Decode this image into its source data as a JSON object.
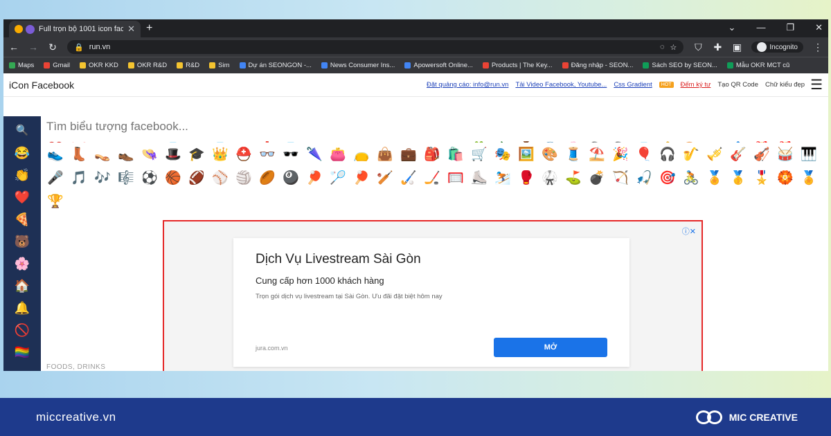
{
  "browser": {
    "tab_title": "Full trọn bộ 1001 icon faceb",
    "url": "run.vn",
    "incognito_label": "Incognito",
    "bookmarks": [
      {
        "label": "Maps",
        "color": "#34a853"
      },
      {
        "label": "Gmail",
        "color": "#ea4335"
      },
      {
        "label": "OKR KKD",
        "color": "#f4c430"
      },
      {
        "label": "OKR R&D",
        "color": "#f4c430"
      },
      {
        "label": "R&D",
        "color": "#f4c430"
      },
      {
        "label": "Sim",
        "color": "#f4c430"
      },
      {
        "label": "Dự án SEONGON -...",
        "color": "#4285f4"
      },
      {
        "label": "News Consumer Ins...",
        "color": "#4285f4"
      },
      {
        "label": "Apowersoft Online...",
        "color": "#4285f4"
      },
      {
        "label": "Products | The Key...",
        "color": "#ea4335"
      },
      {
        "label": "Đăng nhập - SEON...",
        "color": "#ea4335"
      },
      {
        "label": "Sách SEO by SEON...",
        "color": "#0f9d58"
      },
      {
        "label": "Mẫu OKR MCT cũ",
        "color": "#0f9d58"
      }
    ]
  },
  "site": {
    "name": "iCon Facebook",
    "links": [
      {
        "label": "Đặt quảng cáo: info@run.vn",
        "style": "link"
      },
      {
        "label": "Tải Video Facebook, Youtube...",
        "style": "link"
      },
      {
        "label": "Css Gradient",
        "style": "link"
      },
      {
        "label": "Đếm ký tự",
        "style": "red"
      },
      {
        "label": "Tạo QR Code",
        "style": "plain"
      },
      {
        "label": "Chữ kiểu đẹp",
        "style": "plain"
      }
    ],
    "hot_badge": "HOT",
    "search_placeholder": "Tìm biểu tượng facebook..."
  },
  "sidebar_icons": [
    "😂",
    "👏",
    "❤️",
    "🍕",
    "🐻",
    "🌸",
    "🏠",
    "🔔",
    "🚫",
    "🏳️‍🌈"
  ],
  "emoji_rows": {
    "row0": [
      "❤️",
      "🎀",
      "🔻",
      "🔻",
      "🔻",
      "💎",
      "🔻",
      "💎",
      "🔻",
      "❗",
      "💎",
      "🔻",
      "🔻",
      "🔻",
      "🔻",
      "🔺",
      "🔻",
      "🔻",
      "🍀",
      "🎃",
      "🏺",
      "🌊",
      "🌸",
      "🔍",
      "🔍",
      "💎",
      "🔔",
      "🎨",
      "🔻",
      "🔷",
      "🎁",
      "🎁",
      "🎩",
      "🎈"
    ],
    "row1": [
      "👟",
      "👢",
      "👡",
      "👞",
      "👒",
      "🎩",
      "🎓",
      "👑",
      "⛑️",
      "👓",
      "🕶️",
      "🌂",
      "👛",
      "👝",
      "👜",
      "💼",
      "🎒",
      "🛍️",
      "🛒",
      "🎭",
      "🖼️",
      "🎨",
      "🧵",
      "⛱️",
      "🎉",
      "🎈",
      "🎧",
      "🎷",
      "🎺",
      "🎸",
      "🎻",
      "🥁",
      "🎹"
    ],
    "row2": [
      "🎤",
      "🎵",
      "🎶",
      "🎼",
      "⚽",
      "🏀",
      "🏈",
      "⚾",
      "🏐",
      "🏉",
      "🎱",
      "🏓",
      "🏸",
      "🏓",
      "🏏",
      "🏑",
      "🏒",
      "🥅",
      "⛸️",
      "⛷️",
      "🥊",
      "🥋",
      "⛳",
      "💣",
      "🏹",
      "🎣",
      "🎯",
      "🚴",
      "🏅",
      "🥇",
      "🎖️",
      "🏵️",
      "🏅"
    ],
    "row3": [
      "🏆"
    ]
  },
  "ad": {
    "title": "Dịch Vụ Livestream Sài Gòn",
    "subtitle": "Cung cấp hơn 1000 khách hàng",
    "description": "Trọn gói dịch vụ livestream tại Sài Gòn. Ưu đãi đặt biệt hôm nay",
    "domain": "jura.com.vn",
    "button": "MỞ"
  },
  "category_label": "FOODS, DRINKS",
  "footer": {
    "domain": "miccreative.vn",
    "brand": "MIC CREATIVE"
  }
}
